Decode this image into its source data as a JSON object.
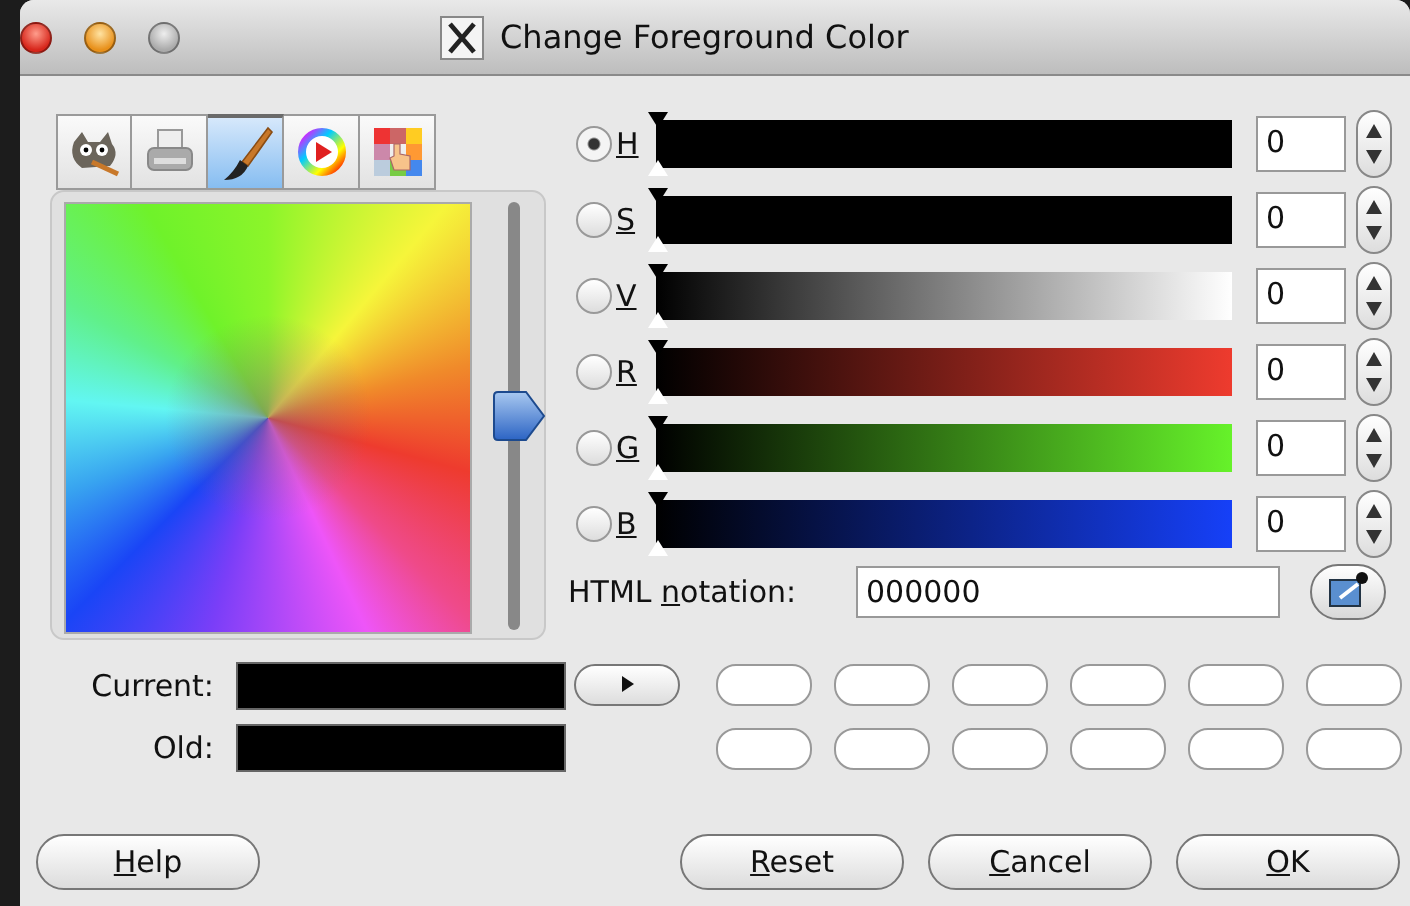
{
  "window": {
    "title": "Change Foreground Color"
  },
  "tabs": [
    {
      "kind": "mascot",
      "selected": false
    },
    {
      "kind": "printer",
      "selected": false
    },
    {
      "kind": "brush",
      "selected": true
    },
    {
      "kind": "wheel",
      "selected": false
    },
    {
      "kind": "palette",
      "selected": false
    }
  ],
  "hue_strip": {
    "level": 0.5
  },
  "channels": [
    {
      "label": "H",
      "selected": true,
      "color": "#000000",
      "level": 0,
      "value": "0"
    },
    {
      "label": "S",
      "selected": false,
      "color": "#000000",
      "level": 0,
      "value": "0"
    },
    {
      "label": "V",
      "selected": false,
      "color": "#ffffff",
      "level": 0,
      "value": "0"
    },
    {
      "label": "R",
      "selected": false,
      "color": "#ee3b2e",
      "level": 0,
      "value": "0"
    },
    {
      "label": "G",
      "selected": false,
      "color": "#66f22a",
      "level": 0,
      "value": "0"
    },
    {
      "label": "B",
      "selected": false,
      "color": "#1640f8",
      "level": 0,
      "value": "0"
    }
  ],
  "html_notation": {
    "before": "HTML ",
    "key": "n",
    "after": "otation:",
    "value": "000000"
  },
  "current": {
    "label": "Current:",
    "color": "#000000"
  },
  "old": {
    "label": "Old:",
    "color": "#000000"
  },
  "history": [
    {
      "color": "#ffffff"
    },
    {
      "color": "#ffffff"
    },
    {
      "color": "#ffffff"
    },
    {
      "color": "#ffffff"
    },
    {
      "color": "#ffffff"
    },
    {
      "color": "#ffffff"
    },
    {
      "color": "#ffffff"
    },
    {
      "color": "#ffffff"
    },
    {
      "color": "#ffffff"
    },
    {
      "color": "#ffffff"
    },
    {
      "color": "#ffffff"
    },
    {
      "color": "#ffffff"
    }
  ],
  "buttons": [
    {
      "key": "H",
      "after": "elp"
    },
    {
      "key": "R",
      "after": "eset"
    },
    {
      "key": "C",
      "after": "ancel"
    },
    {
      "key": "O",
      "after": "K"
    }
  ]
}
